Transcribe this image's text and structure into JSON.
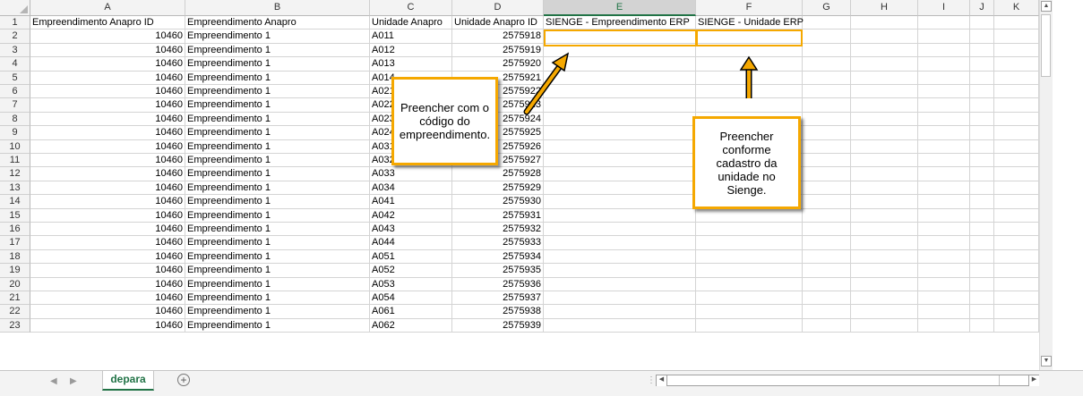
{
  "columns": [
    "A",
    "B",
    "C",
    "D",
    "E",
    "F",
    "G",
    "H",
    "I",
    "J",
    "K"
  ],
  "selected_column": "E",
  "rows": [
    {
      "n": "1",
      "a": "Empreendimento Anapro ID",
      "b": "Empreendimento Anapro",
      "c": "Unidade Anapro",
      "d": "Unidade Anapro ID",
      "e": "SIENGE - Empreendimento ERP",
      "f": "SIENGE - Unidade ERP"
    },
    {
      "n": "2",
      "a": "10460",
      "b": "Empreendimento 1",
      "c": "A011",
      "d": "2575918",
      "e": "",
      "f": ""
    },
    {
      "n": "3",
      "a": "10460",
      "b": "Empreendimento 1",
      "c": "A012",
      "d": "2575919",
      "e": "",
      "f": ""
    },
    {
      "n": "4",
      "a": "10460",
      "b": "Empreendimento 1",
      "c": "A013",
      "d": "2575920",
      "e": "",
      "f": ""
    },
    {
      "n": "5",
      "a": "10460",
      "b": "Empreendimento 1",
      "c": "A014",
      "d": "2575921",
      "e": "",
      "f": ""
    },
    {
      "n": "6",
      "a": "10460",
      "b": "Empreendimento 1",
      "c": "A021",
      "d": "2575922",
      "e": "",
      "f": ""
    },
    {
      "n": "7",
      "a": "10460",
      "b": "Empreendimento 1",
      "c": "A022",
      "d": "2575923",
      "e": "",
      "f": ""
    },
    {
      "n": "8",
      "a": "10460",
      "b": "Empreendimento 1",
      "c": "A023",
      "d": "2575924",
      "e": "",
      "f": ""
    },
    {
      "n": "9",
      "a": "10460",
      "b": "Empreendimento 1",
      "c": "A024",
      "d": "2575925",
      "e": "",
      "f": ""
    },
    {
      "n": "10",
      "a": "10460",
      "b": "Empreendimento 1",
      "c": "A031",
      "d": "2575926",
      "e": "",
      "f": ""
    },
    {
      "n": "11",
      "a": "10460",
      "b": "Empreendimento 1",
      "c": "A032",
      "d": "2575927",
      "e": "",
      "f": ""
    },
    {
      "n": "12",
      "a": "10460",
      "b": "Empreendimento 1",
      "c": "A033",
      "d": "2575928",
      "e": "",
      "f": ""
    },
    {
      "n": "13",
      "a": "10460",
      "b": "Empreendimento 1",
      "c": "A034",
      "d": "2575929",
      "e": "",
      "f": ""
    },
    {
      "n": "14",
      "a": "10460",
      "b": "Empreendimento 1",
      "c": "A041",
      "d": "2575930",
      "e": "",
      "f": ""
    },
    {
      "n": "15",
      "a": "10460",
      "b": "Empreendimento 1",
      "c": "A042",
      "d": "2575931",
      "e": "",
      "f": ""
    },
    {
      "n": "16",
      "a": "10460",
      "b": "Empreendimento 1",
      "c": "A043",
      "d": "2575932",
      "e": "",
      "f": ""
    },
    {
      "n": "17",
      "a": "10460",
      "b": "Empreendimento 1",
      "c": "A044",
      "d": "2575933",
      "e": "",
      "f": ""
    },
    {
      "n": "18",
      "a": "10460",
      "b": "Empreendimento 1",
      "c": "A051",
      "d": "2575934",
      "e": "",
      "f": ""
    },
    {
      "n": "19",
      "a": "10460",
      "b": "Empreendimento 1",
      "c": "A052",
      "d": "2575935",
      "e": "",
      "f": ""
    },
    {
      "n": "20",
      "a": "10460",
      "b": "Empreendimento 1",
      "c": "A053",
      "d": "2575936",
      "e": "",
      "f": ""
    },
    {
      "n": "21",
      "a": "10460",
      "b": "Empreendimento 1",
      "c": "A054",
      "d": "2575937",
      "e": "",
      "f": ""
    },
    {
      "n": "22",
      "a": "10460",
      "b": "Empreendimento 1",
      "c": "A061",
      "d": "2575938",
      "e": "",
      "f": ""
    },
    {
      "n": "23",
      "a": "10460",
      "b": "Empreendimento 1",
      "c": "A062",
      "d": "2575939",
      "e": "",
      "f": ""
    }
  ],
  "annotations": {
    "callout_empreendimento": "Preencher com o código do empreendimento.",
    "callout_unidade": "Preencher conforme cadastro da unidade no Sienge.",
    "highlight_color": "#f5a800"
  },
  "sheet_tabs": [
    {
      "label": "depara",
      "active": true
    }
  ],
  "add_sheet_icon": "plus-circle-icon",
  "accent_color": "#217346"
}
